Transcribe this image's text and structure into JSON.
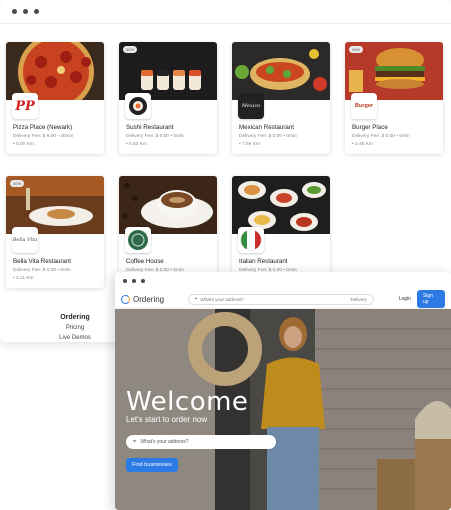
{
  "restaurants": [
    {
      "name": "Pizza Place (Newark)",
      "fee": "Delivery Fee: $ 9.00 - 40min",
      "dist": "• 0.00 Km",
      "badge": "",
      "logo_text": "PP"
    },
    {
      "name": "Sushi Restaurant",
      "fee": "Delivery Fee: $ 0.00 • 0min",
      "dist": "• 6.83 Km",
      "badge": "30%",
      "logo_text": ""
    },
    {
      "name": "Mexican Restaurant",
      "fee": "Delivery Fee: $ 0.00 • 0min",
      "dist": "• 7.59 Km",
      "badge": "30%",
      "logo_text": "Mexico"
    },
    {
      "name": "Burger Place",
      "fee": "Delivery Fee: $ 0.00 • 0min",
      "dist": "• 2.46 Km",
      "badge": "30%",
      "logo_text": "Burger"
    },
    {
      "name": "Bella Vita Restaurant",
      "fee": "Delivery Fee: $ 0.00 • 0min",
      "dist": "• 4.11 Km",
      "badge": "30%",
      "logo_text": "Bella Vita"
    },
    {
      "name": "Coffee House",
      "fee": "Delivery Fee: $ 0.00 • 0min",
      "dist": "",
      "badge": "",
      "logo_text": ""
    },
    {
      "name": "Italian Restaurant",
      "fee": "Delivery Fee: $ 0.00 • 0min",
      "dist": "",
      "badge": "",
      "logo_text": "Italian"
    }
  ],
  "footer": {
    "title": "Ordering",
    "items": [
      "Pricing",
      "Live Demos"
    ]
  },
  "front": {
    "brand": "Ordering",
    "address_placeholder": "What's your address?",
    "delivery_label": "Delivery",
    "login": "Login",
    "signup": "Sign up",
    "hero_title": "Welcome",
    "hero_subtitle": "Let's start to order now",
    "search_placeholder": "What's your address?",
    "find_button": "Find businesses"
  },
  "icons": {
    "location": "pin-icon"
  },
  "colors": {
    "accent": "#2c7be5"
  }
}
